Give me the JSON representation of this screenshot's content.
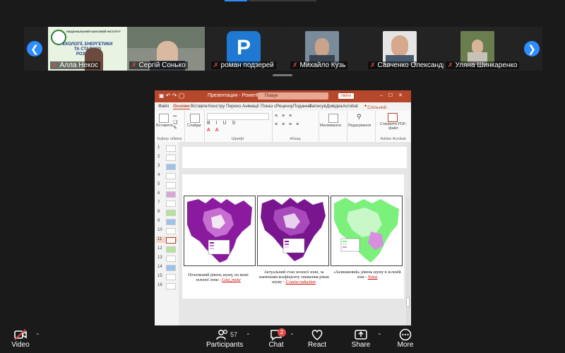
{
  "participants_strip": {
    "tiles": [
      {
        "name": "Алла Некос"
      },
      {
        "name": "Сергій Сонько"
      },
      {
        "name": "роман подзерей",
        "initial": "P"
      },
      {
        "name": "Михайло Кузь"
      },
      {
        "name": "Савченко Олександр..."
      },
      {
        "name": "Уляна Шинкаренко"
      }
    ],
    "banner_lines": [
      "НАЦІОНАЛЬНИЙ НАУКОВИЙ ІНСТИТУТ",
      "ЕКОЛОГІЇ, ЕНЕРГЕТИКИ",
      "ТА СТАЛОГО",
      "РОЗВИТКУ"
    ]
  },
  "powerpoint": {
    "title": "Презентация - PowerPoint",
    "search_placeholder": "Пошук",
    "user_badge": "Увійти",
    "tabs": [
      "Файл",
      "Основн",
      "Вставле",
      "Констру",
      "Перехо",
      "Анімації",
      "Показ с",
      "Рецензу",
      "Подання",
      "Записув",
      "Довідка",
      "Acrobat"
    ],
    "share": "Спільний доступ",
    "ribbon": {
      "clipboard_label": "Буфер обміну",
      "paste": "Вставити",
      "slides_btn": "Слайди",
      "font_label": "Шрифт",
      "paragraph_label": "Абзац",
      "drawing": "Малювання",
      "editing": "Редагування",
      "create_pdf": "Створити PDF-файл",
      "adobe_label": "Adobe Acrobat"
    },
    "slide_numbers": [
      "1",
      "2",
      "3",
      "4",
      "5",
      "6",
      "7",
      "8",
      "9",
      "10",
      "11",
      "12",
      "13",
      "14",
      "15",
      "16"
    ],
    "selected_slide": "11",
    "slide_captions": {
      "left": "Початковий рівень шуму, на межі зеленої зони -",
      "left_link": "Cost_noise",
      "middle": "Актуальний стан зеленої зони, за значенням коефіцієнту зниження рівня шуму -",
      "middle_link": "C.noise reduction",
      "right": "«Залишковий» рівень шуму в зеленій зоні -",
      "right_link": "Noise"
    }
  },
  "toolbar": {
    "video": "Video",
    "participants": "Participants",
    "participants_count": "57",
    "chat": "Chat",
    "chat_badge": "2",
    "react": "React",
    "share": "Share",
    "more": "More"
  },
  "colors": {
    "accent": "#2d8cff",
    "ppt_red": "#b7472a",
    "mic_off": "#e34b4b"
  }
}
